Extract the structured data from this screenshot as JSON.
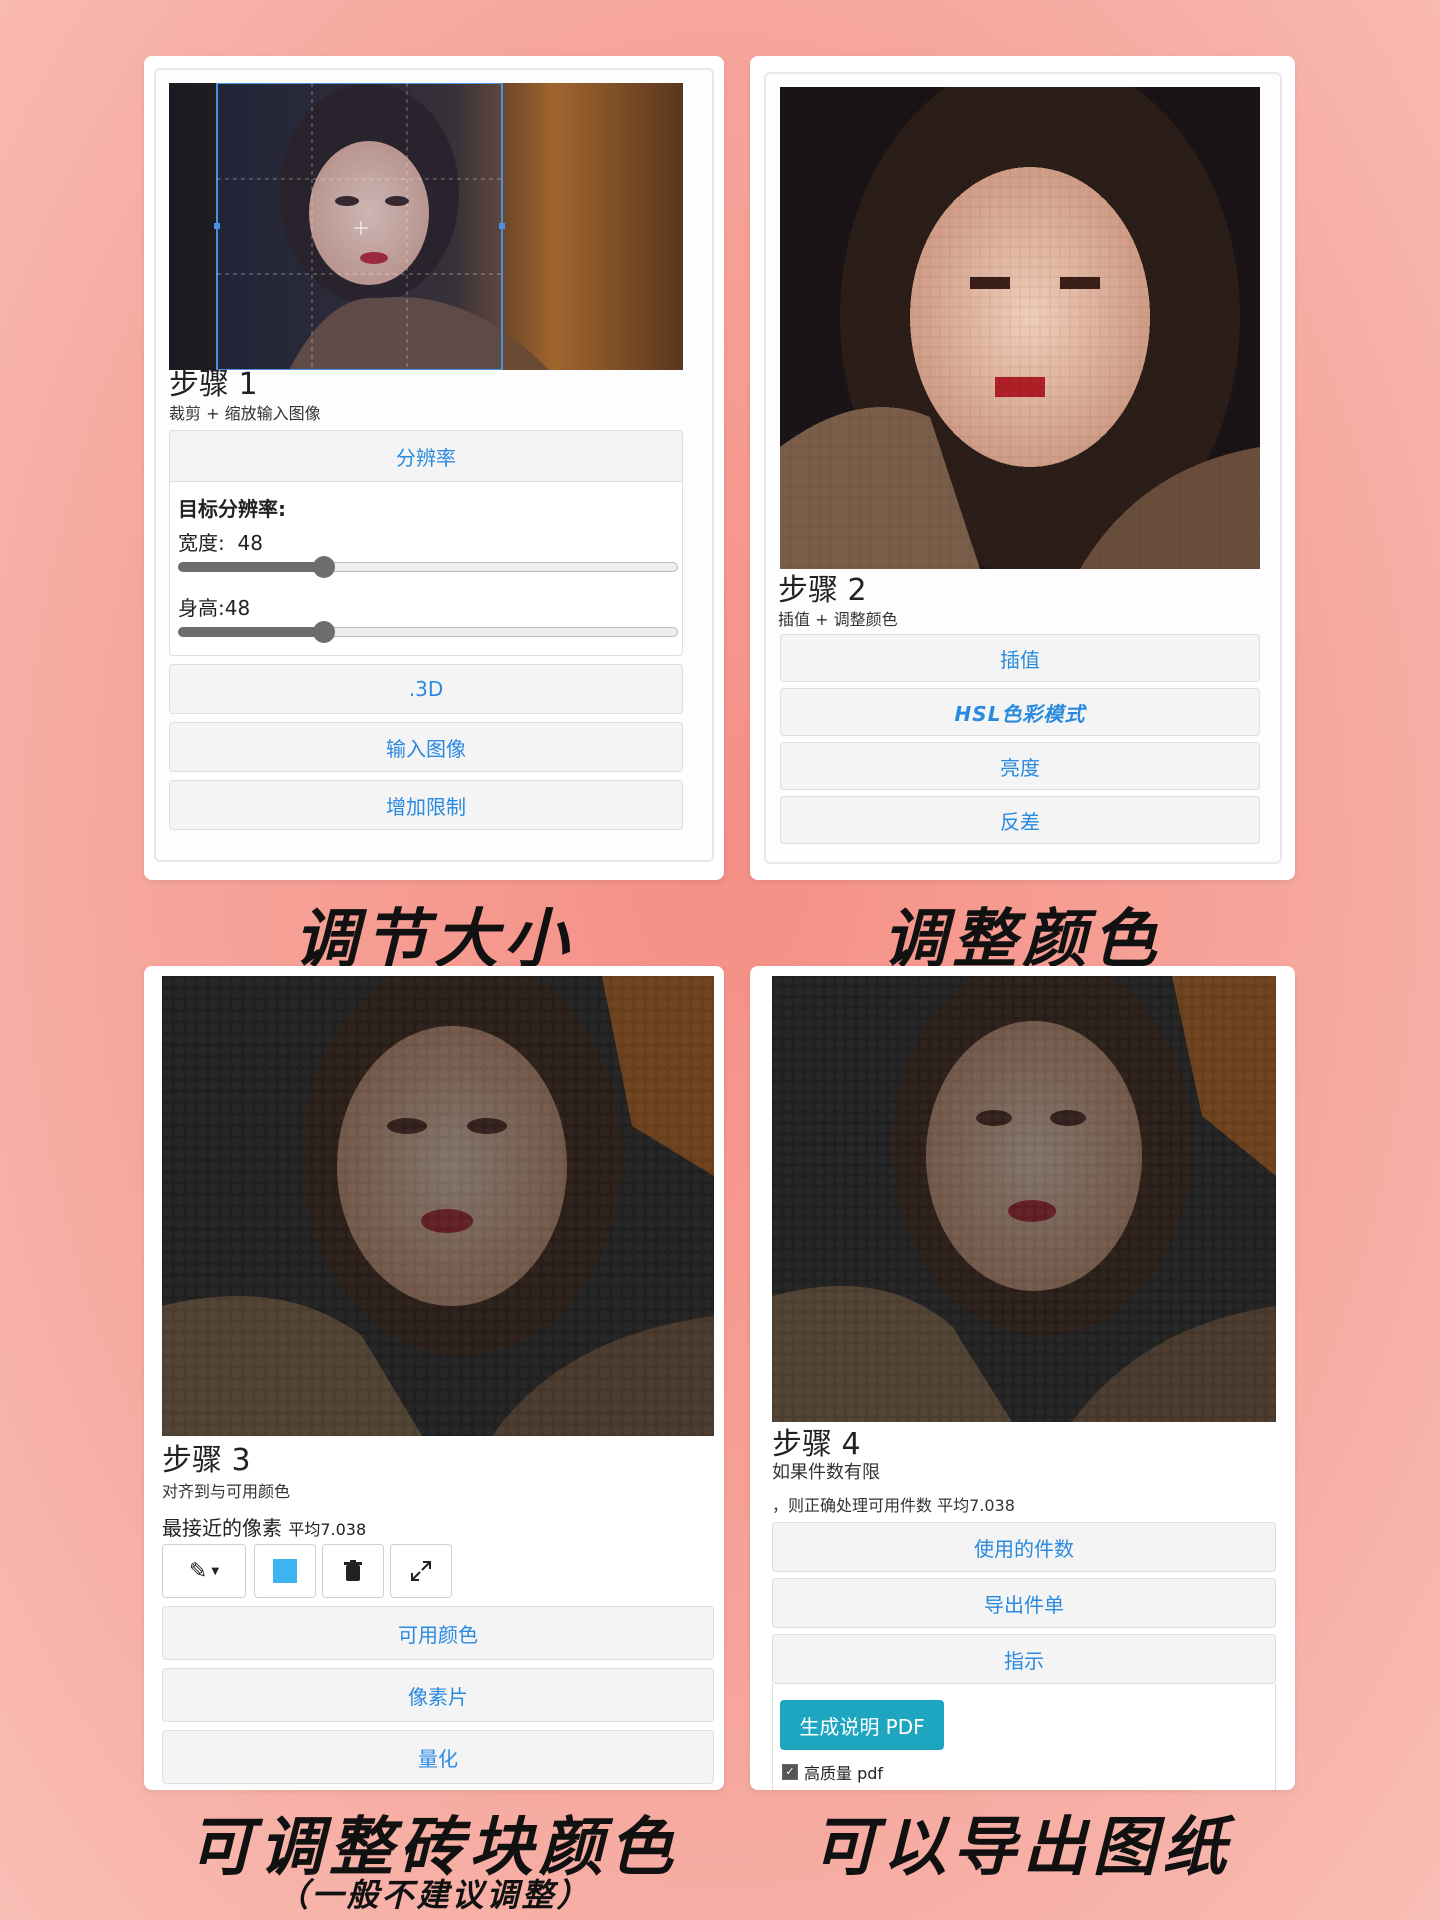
{
  "panel1": {
    "step_title": "步骤 1",
    "step_sub": "裁剪 + 缩放输入图像",
    "section_header": "分辨率",
    "target_label": "目标分辨率:",
    "width_label": "宽度:",
    "width_value": "48",
    "height_label": "身高:",
    "height_value": "48",
    "width_slider_fraction": 0.29,
    "height_slider_fraction": 0.29,
    "buttons": [
      ".3D",
      "输入图像",
      "增加限制"
    ]
  },
  "panel2": {
    "step_title": "步骤 2",
    "step_sub": "插值 + 调整颜色",
    "buttons": [
      "插值",
      "HSL色彩模式",
      "亮度",
      "反差"
    ]
  },
  "panel3": {
    "step_title": "步骤 3",
    "step_sub": "对齐到与可用颜色",
    "nearest_label": "最接近的像素",
    "avg_label": "平均7.038",
    "swatch_color": "#3db3ef",
    "tools": [
      "brush-icon",
      "color-swatch",
      "trash-icon",
      "expand-icon"
    ],
    "buttons": [
      "可用颜色",
      "像素片",
      "量化"
    ]
  },
  "panel4": {
    "step_title": "步骤 4",
    "step_sub1": "如果件数有限",
    "step_sub2": "，则正确处理可用件数",
    "avg_label": "平均7.038",
    "buttons": [
      "使用的件数",
      "导出件单",
      "指示"
    ],
    "primary_button": "生成说明 PDF",
    "checkbox_label": "高质量 pdf",
    "checkbox_checked": true
  },
  "captions": {
    "c1": "调节大小",
    "c2": "调整颜色",
    "c3": "可调整砖块颜色",
    "c3_sub": "（一般不建议调整）",
    "c4": "可以导出图纸"
  },
  "colors": {
    "accent": "#2a8ae0",
    "primary": "#1ea6c1",
    "background": "#f6a59b"
  }
}
